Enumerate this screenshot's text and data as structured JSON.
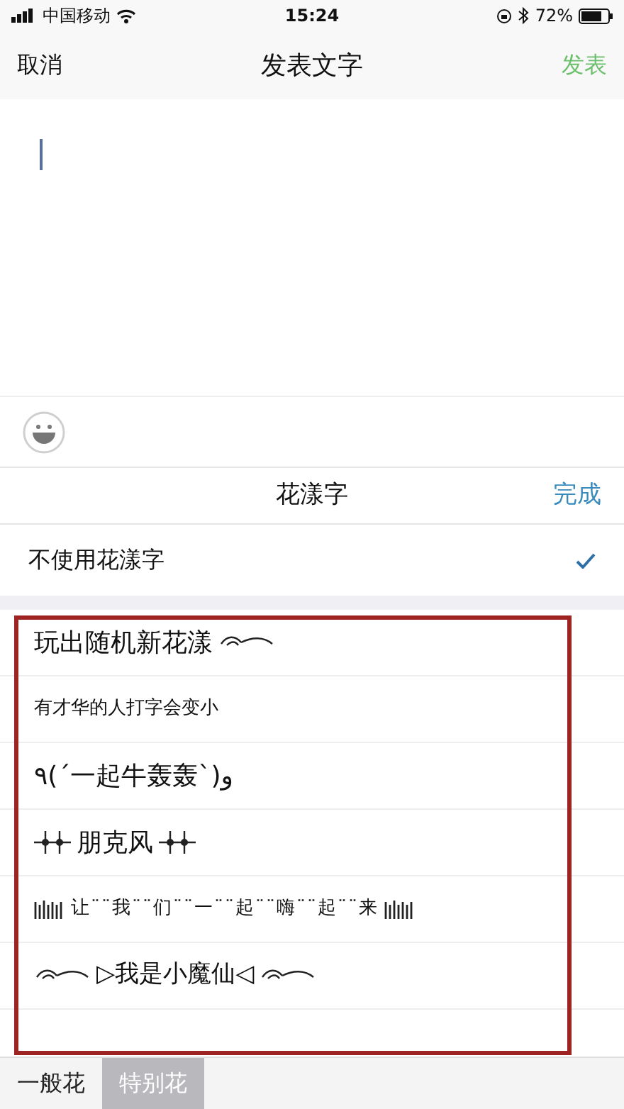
{
  "status_bar": {
    "carrier": "中国移动",
    "time": "15:24",
    "battery": "72%"
  },
  "nav": {
    "cancel": "取消",
    "title": "发表文字",
    "publish": "发表",
    "publish_disabled": true
  },
  "panel": {
    "title": "花漾字",
    "done": "完成"
  },
  "none_option": {
    "label": "不使用花漾字",
    "selected": true
  },
  "styles": [
    {
      "kind": "swirl",
      "label": "玩出随机新花漾"
    },
    {
      "kind": "small",
      "label": "有才华的人打字会变小"
    },
    {
      "kind": "plain",
      "label": "٩(ˊ一起牛轰轰ˋ)و"
    },
    {
      "kind": "punk",
      "label": "朋克风"
    },
    {
      "kind": "dots",
      "label": "让¨¨我¨¨们¨¨一¨¨起¨¨嗨¨¨起¨¨来"
    },
    {
      "kind": "magic",
      "label": "▷我是小魔仙◁"
    }
  ],
  "tabs": [
    {
      "label": "一般花",
      "selected": false
    },
    {
      "label": "特别花",
      "selected": true
    }
  ]
}
